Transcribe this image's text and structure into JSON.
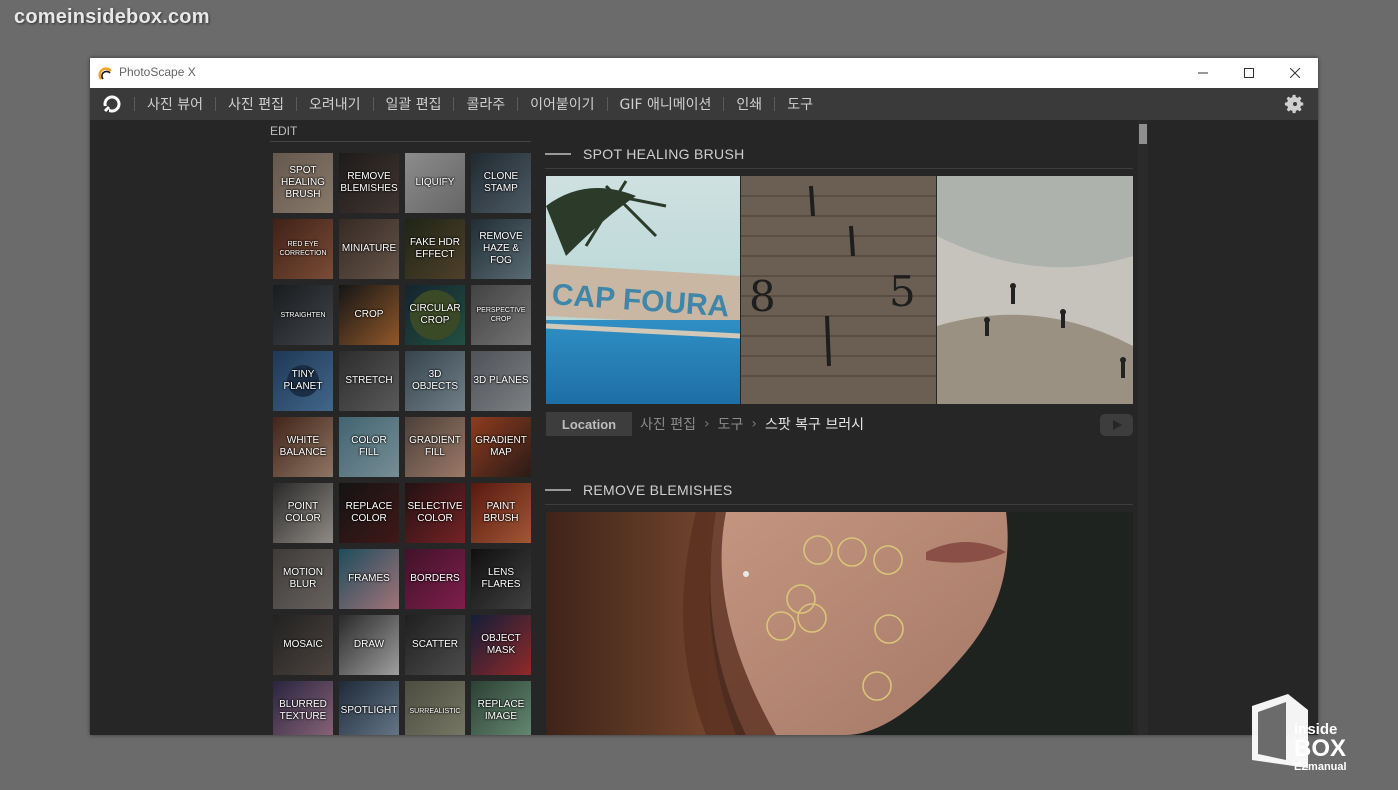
{
  "watermark": "comeinsidebox.com",
  "window": {
    "title": "PhotoScape X"
  },
  "menu": {
    "items": [
      "사진 뷰어",
      "사진 편집",
      "오려내기",
      "일괄 편집",
      "콜라주",
      "이어붙이기",
      "GIF 애니메이션",
      "인쇄",
      "도구"
    ]
  },
  "edit": {
    "label": "EDIT",
    "tiles": [
      {
        "label": "SPOT HEALING BRUSH",
        "icon": "spot-healing"
      },
      {
        "label": "REMOVE BLEMISHES",
        "icon": "remove-blemishes"
      },
      {
        "label": "LIQUIFY",
        "icon": "liquify"
      },
      {
        "label": "CLONE STAMP",
        "icon": "clone-stamp"
      },
      {
        "label": "RED EYE CORRECTION",
        "icon": "red-eye"
      },
      {
        "label": "MINIATURE",
        "icon": "miniature"
      },
      {
        "label": "FAKE HDR EFFECT",
        "icon": "fake-hdr"
      },
      {
        "label": "REMOVE HAZE & FOG",
        "icon": "remove-haze"
      },
      {
        "label": "STRAIGHTEN",
        "icon": "straighten"
      },
      {
        "label": "CROP",
        "icon": "crop"
      },
      {
        "label": "CIRCULAR CROP",
        "icon": "circular-crop"
      },
      {
        "label": "PERSPECTIVE CROP",
        "icon": "perspective-crop"
      },
      {
        "label": "TINY PLANET",
        "icon": "tiny-planet"
      },
      {
        "label": "STRETCH",
        "icon": "stretch"
      },
      {
        "label": "3D OBJECTS",
        "icon": "3d-objects"
      },
      {
        "label": "3D PLANES",
        "icon": "3d-planes"
      },
      {
        "label": "WHITE BALANCE",
        "icon": "white-balance"
      },
      {
        "label": "COLOR FILL",
        "icon": "color-fill"
      },
      {
        "label": "GRADIENT FILL",
        "icon": "gradient-fill"
      },
      {
        "label": "GRADIENT MAP",
        "icon": "gradient-map"
      },
      {
        "label": "POINT COLOR",
        "icon": "point-color"
      },
      {
        "label": "REPLACE COLOR",
        "icon": "replace-color"
      },
      {
        "label": "SELECTIVE COLOR",
        "icon": "selective-color"
      },
      {
        "label": "PAINT BRUSH",
        "icon": "paint-brush"
      },
      {
        "label": "MOTION BLUR",
        "icon": "motion-blur"
      },
      {
        "label": "FRAMES",
        "icon": "frames"
      },
      {
        "label": "BORDERS",
        "icon": "borders"
      },
      {
        "label": "LENS FLARES",
        "icon": "lens-flares"
      },
      {
        "label": "MOSAIC",
        "icon": "mosaic"
      },
      {
        "label": "DRAW",
        "icon": "draw"
      },
      {
        "label": "SCATTER",
        "icon": "scatter"
      },
      {
        "label": "OBJECT MASK",
        "icon": "object-mask"
      },
      {
        "label": "BLURRED TEXTURE",
        "icon": "blurred-texture"
      },
      {
        "label": "SPOTLIGHT",
        "icon": "spotlight"
      },
      {
        "label": "SURREALISTIC",
        "icon": "surrealistic"
      },
      {
        "label": "REPLACE IMAGE",
        "icon": "replace-image"
      }
    ]
  },
  "sections": [
    {
      "title": "SPOT HEALING BRUSH",
      "location_button": "Location",
      "breadcrumb": [
        "사진 편집",
        "도구",
        "스팟 복구 브러시"
      ]
    },
    {
      "title": "REMOVE BLEMISHES"
    }
  ],
  "brand": {
    "line1": "inside",
    "line2": "BOX",
    "line3": "EZmanual"
  }
}
